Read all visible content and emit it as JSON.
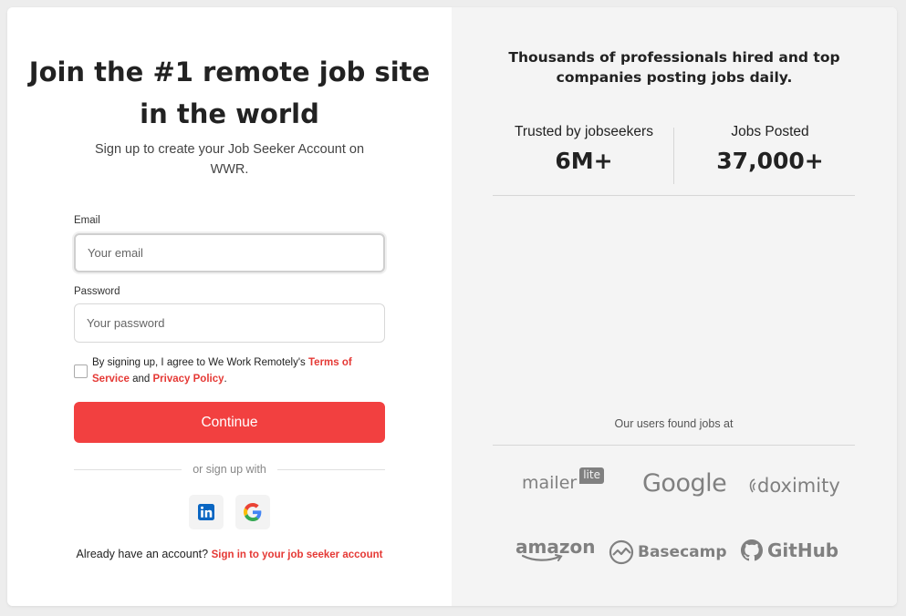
{
  "left": {
    "heading": "Join the #1 remote job site in the world",
    "subheading": "Sign up to create your Job Seeker Account on WWR.",
    "email_label": "Email",
    "email_placeholder": "Your email",
    "password_label": "Password",
    "password_placeholder": "Your password",
    "terms_prefix": "By signing up, I agree to We Work Remotely's ",
    "terms_link": "Terms of Service",
    "terms_and": " and ",
    "privacy_link": "Privacy Policy",
    "terms_suffix": ".",
    "continue_label": "Continue",
    "divider_text": "or sign up with",
    "social": [
      {
        "name": "linkedin-icon",
        "glyph": "in",
        "color": "#0a66c2"
      },
      {
        "name": "google-icon",
        "glyph": "G"
      }
    ],
    "already_text": "Already have an account? ",
    "signin_link": "Sign in to your job seeker account"
  },
  "right": {
    "heading": "Thousands of professionals hired and top companies posting jobs daily.",
    "stats": [
      {
        "label": "Trusted by jobseekers",
        "value": "6M+"
      },
      {
        "label": "Jobs Posted",
        "value": "37,000+"
      }
    ],
    "found_text": "Our users found jobs at",
    "logos": {
      "mailer": "mailer",
      "lite": "lite",
      "google": "Google",
      "doximity": "doximity",
      "amazon": "amazon",
      "basecamp": "Basecamp",
      "github": "GitHub"
    }
  },
  "colors": {
    "accent": "#f24040",
    "link": "#e53935",
    "right_bg": "#f4f4f4",
    "logo_gray": "#808080"
  }
}
